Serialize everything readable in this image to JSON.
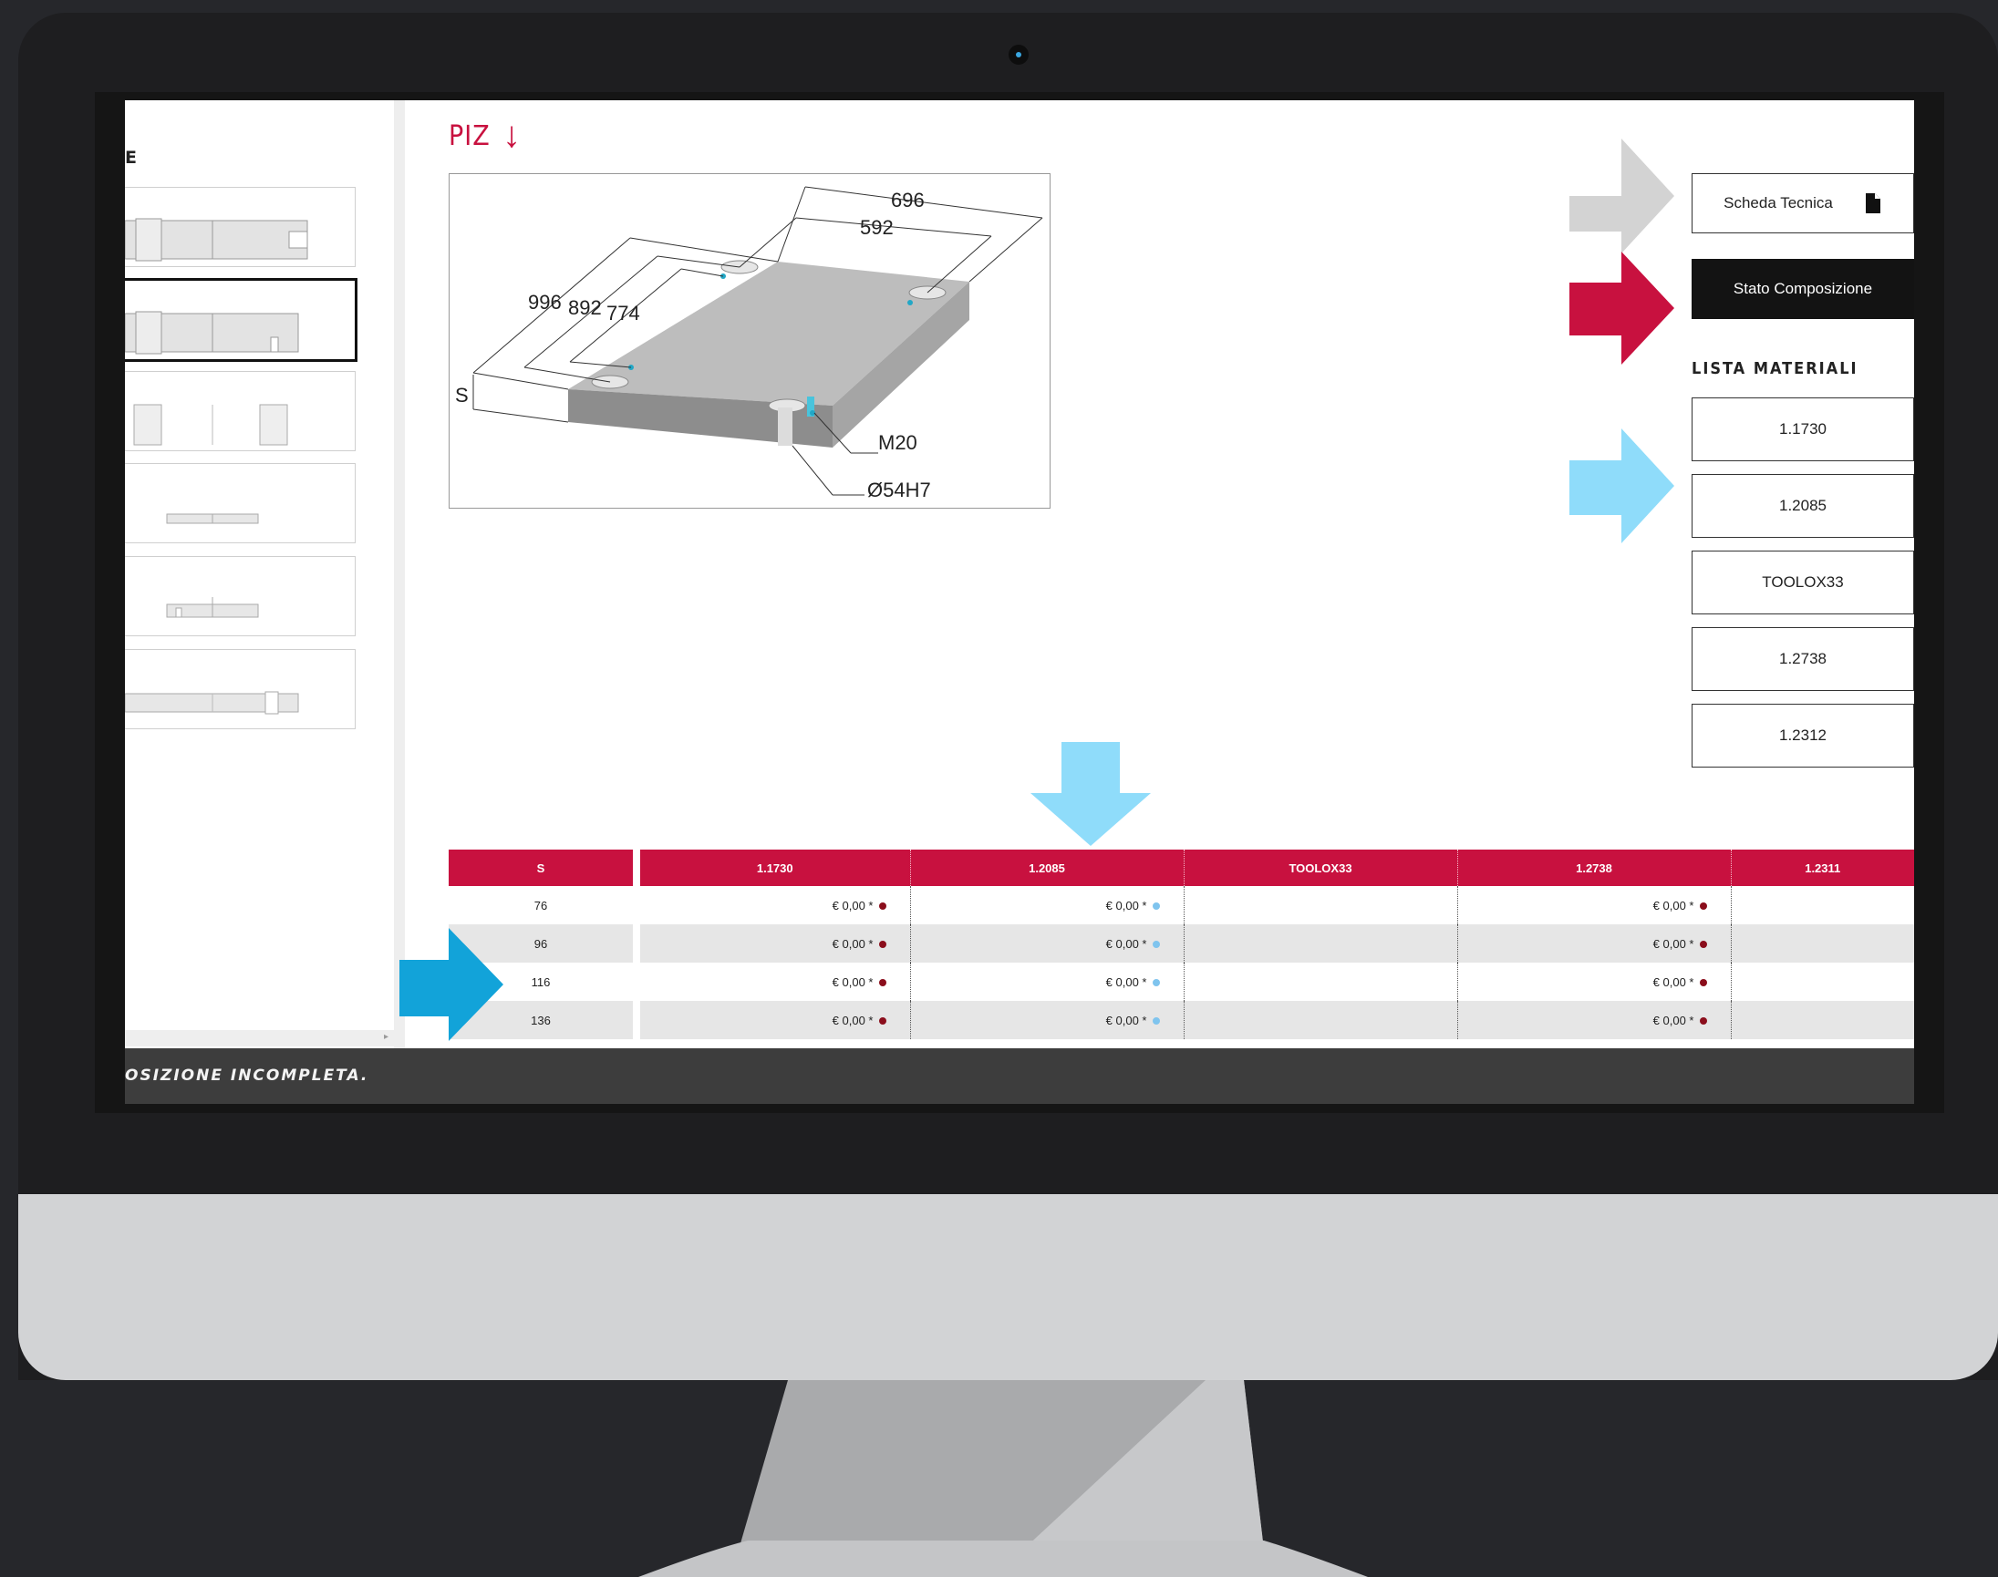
{
  "sidebar": {
    "header_fragment": "E",
    "thumbnails": [
      "thumb-1",
      "thumb-2",
      "thumb-3",
      "thumb-4",
      "thumb-5",
      "thumb-6"
    ],
    "selected_index": 1
  },
  "part": {
    "title": "PIZ",
    "title_arrow": "↓",
    "dimensions": {
      "d696": "696",
      "d592": "592",
      "d996": "996",
      "d892": "892",
      "d774": "774",
      "s": "S",
      "m20": "M20",
      "bore": "Ø54H7"
    }
  },
  "actions": {
    "scheda_tecnica": "Scheda Tecnica",
    "stato_composizione": "Stato Composizione"
  },
  "materials": {
    "title": "LISTA MATERIALI",
    "items": [
      "1.1730",
      "1.2085",
      "TOOLOX33",
      "1.2738",
      "1.2312"
    ]
  },
  "price_table": {
    "headers": [
      "S",
      "1.1730",
      "1.2085",
      "TOOLOX33",
      "1.2738",
      "1.2311"
    ],
    "rows": [
      {
        "s": "76",
        "c1": "€ 0,00 *",
        "c2": "€ 0,00 *",
        "c3": "",
        "c4": "€ 0,00 *",
        "c5": ""
      },
      {
        "s": "96",
        "c1": "€ 0,00 *",
        "c2": "€ 0,00 *",
        "c3": "",
        "c4": "€ 0,00 *",
        "c5": ""
      },
      {
        "s": "116",
        "c1": "€ 0,00 *",
        "c2": "€ 0,00 *",
        "c3": "",
        "c4": "€ 0,00 *",
        "c5": ""
      },
      {
        "s": "136",
        "c1": "€ 0,00 *",
        "c2": "€ 0,00 *",
        "c3": "",
        "c4": "€ 0,00 *",
        "c5": ""
      }
    ],
    "dot_colors": {
      "c1": "#8b0e1c",
      "c2": "#7fc4ee",
      "c4": "#8b0e1c"
    }
  },
  "footer": {
    "status": "OSIZIONE INCOMPLETA."
  },
  "colors": {
    "accent": "#c8113f",
    "arrow_gray": "#d3d3d3",
    "arrow_red": "#c8113f",
    "arrow_lightblue": "#8fdcfa",
    "arrow_blue": "#12a3d9",
    "page_background": "#26272b"
  },
  "icons": {
    "scheda_tecnica": "document-icon",
    "camera": "camera-icon"
  }
}
